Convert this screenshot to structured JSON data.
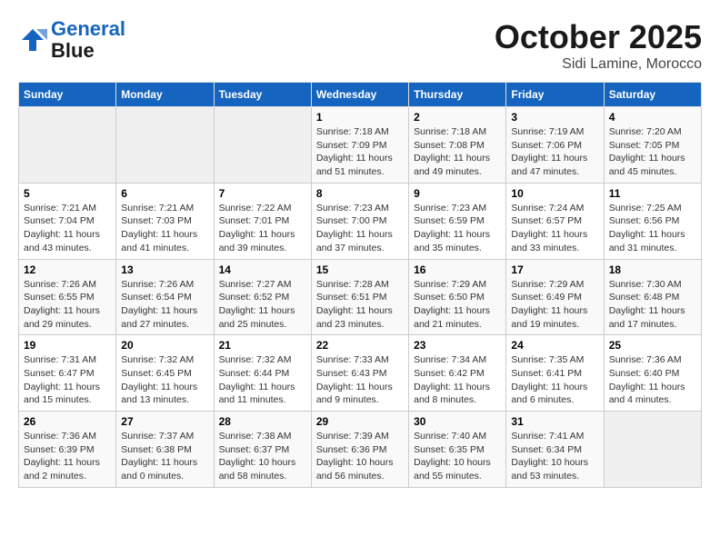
{
  "header": {
    "logo_line1": "General",
    "logo_line2": "Blue",
    "month": "October 2025",
    "location": "Sidi Lamine, Morocco"
  },
  "weekdays": [
    "Sunday",
    "Monday",
    "Tuesday",
    "Wednesday",
    "Thursday",
    "Friday",
    "Saturday"
  ],
  "weeks": [
    [
      {
        "day": "",
        "info": ""
      },
      {
        "day": "",
        "info": ""
      },
      {
        "day": "",
        "info": ""
      },
      {
        "day": "1",
        "info": "Sunrise: 7:18 AM\nSunset: 7:09 PM\nDaylight: 11 hours\nand 51 minutes."
      },
      {
        "day": "2",
        "info": "Sunrise: 7:18 AM\nSunset: 7:08 PM\nDaylight: 11 hours\nand 49 minutes."
      },
      {
        "day": "3",
        "info": "Sunrise: 7:19 AM\nSunset: 7:06 PM\nDaylight: 11 hours\nand 47 minutes."
      },
      {
        "day": "4",
        "info": "Sunrise: 7:20 AM\nSunset: 7:05 PM\nDaylight: 11 hours\nand 45 minutes."
      }
    ],
    [
      {
        "day": "5",
        "info": "Sunrise: 7:21 AM\nSunset: 7:04 PM\nDaylight: 11 hours\nand 43 minutes."
      },
      {
        "day": "6",
        "info": "Sunrise: 7:21 AM\nSunset: 7:03 PM\nDaylight: 11 hours\nand 41 minutes."
      },
      {
        "day": "7",
        "info": "Sunrise: 7:22 AM\nSunset: 7:01 PM\nDaylight: 11 hours\nand 39 minutes."
      },
      {
        "day": "8",
        "info": "Sunrise: 7:23 AM\nSunset: 7:00 PM\nDaylight: 11 hours\nand 37 minutes."
      },
      {
        "day": "9",
        "info": "Sunrise: 7:23 AM\nSunset: 6:59 PM\nDaylight: 11 hours\nand 35 minutes."
      },
      {
        "day": "10",
        "info": "Sunrise: 7:24 AM\nSunset: 6:57 PM\nDaylight: 11 hours\nand 33 minutes."
      },
      {
        "day": "11",
        "info": "Sunrise: 7:25 AM\nSunset: 6:56 PM\nDaylight: 11 hours\nand 31 minutes."
      }
    ],
    [
      {
        "day": "12",
        "info": "Sunrise: 7:26 AM\nSunset: 6:55 PM\nDaylight: 11 hours\nand 29 minutes."
      },
      {
        "day": "13",
        "info": "Sunrise: 7:26 AM\nSunset: 6:54 PM\nDaylight: 11 hours\nand 27 minutes."
      },
      {
        "day": "14",
        "info": "Sunrise: 7:27 AM\nSunset: 6:52 PM\nDaylight: 11 hours\nand 25 minutes."
      },
      {
        "day": "15",
        "info": "Sunrise: 7:28 AM\nSunset: 6:51 PM\nDaylight: 11 hours\nand 23 minutes."
      },
      {
        "day": "16",
        "info": "Sunrise: 7:29 AM\nSunset: 6:50 PM\nDaylight: 11 hours\nand 21 minutes."
      },
      {
        "day": "17",
        "info": "Sunrise: 7:29 AM\nSunset: 6:49 PM\nDaylight: 11 hours\nand 19 minutes."
      },
      {
        "day": "18",
        "info": "Sunrise: 7:30 AM\nSunset: 6:48 PM\nDaylight: 11 hours\nand 17 minutes."
      }
    ],
    [
      {
        "day": "19",
        "info": "Sunrise: 7:31 AM\nSunset: 6:47 PM\nDaylight: 11 hours\nand 15 minutes."
      },
      {
        "day": "20",
        "info": "Sunrise: 7:32 AM\nSunset: 6:45 PM\nDaylight: 11 hours\nand 13 minutes."
      },
      {
        "day": "21",
        "info": "Sunrise: 7:32 AM\nSunset: 6:44 PM\nDaylight: 11 hours\nand 11 minutes."
      },
      {
        "day": "22",
        "info": "Sunrise: 7:33 AM\nSunset: 6:43 PM\nDaylight: 11 hours\nand 9 minutes."
      },
      {
        "day": "23",
        "info": "Sunrise: 7:34 AM\nSunset: 6:42 PM\nDaylight: 11 hours\nand 8 minutes."
      },
      {
        "day": "24",
        "info": "Sunrise: 7:35 AM\nSunset: 6:41 PM\nDaylight: 11 hours\nand 6 minutes."
      },
      {
        "day": "25",
        "info": "Sunrise: 7:36 AM\nSunset: 6:40 PM\nDaylight: 11 hours\nand 4 minutes."
      }
    ],
    [
      {
        "day": "26",
        "info": "Sunrise: 7:36 AM\nSunset: 6:39 PM\nDaylight: 11 hours\nand 2 minutes."
      },
      {
        "day": "27",
        "info": "Sunrise: 7:37 AM\nSunset: 6:38 PM\nDaylight: 11 hours\nand 0 minutes."
      },
      {
        "day": "28",
        "info": "Sunrise: 7:38 AM\nSunset: 6:37 PM\nDaylight: 10 hours\nand 58 minutes."
      },
      {
        "day": "29",
        "info": "Sunrise: 7:39 AM\nSunset: 6:36 PM\nDaylight: 10 hours\nand 56 minutes."
      },
      {
        "day": "30",
        "info": "Sunrise: 7:40 AM\nSunset: 6:35 PM\nDaylight: 10 hours\nand 55 minutes."
      },
      {
        "day": "31",
        "info": "Sunrise: 7:41 AM\nSunset: 6:34 PM\nDaylight: 10 hours\nand 53 minutes."
      },
      {
        "day": "",
        "info": ""
      }
    ]
  ]
}
